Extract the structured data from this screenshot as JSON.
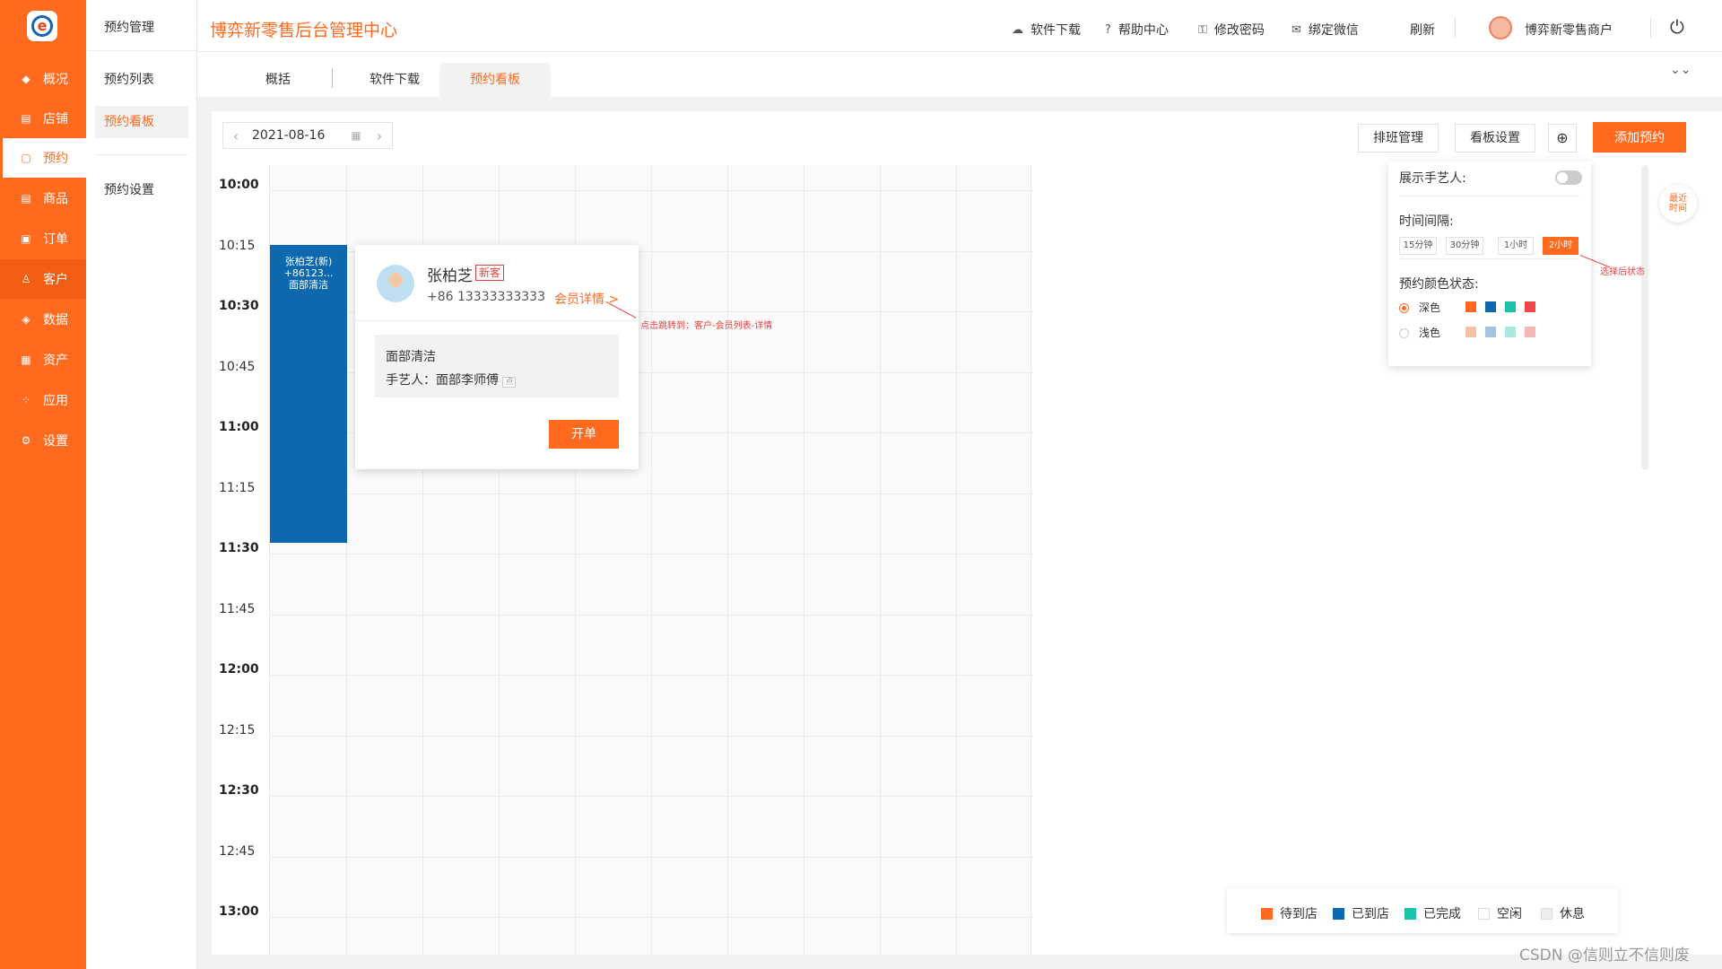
{
  "nav": {
    "items": [
      {
        "icon": "diamond-icon",
        "glyph": "◆",
        "label": "概况"
      },
      {
        "icon": "store-icon",
        "glyph": "▤",
        "label": "店铺"
      },
      {
        "icon": "calendar-icon",
        "glyph": "▢",
        "label": "预约"
      },
      {
        "icon": "goods-icon",
        "glyph": "▤",
        "label": "商品"
      },
      {
        "icon": "order-icon",
        "glyph": "▣",
        "label": "订单"
      },
      {
        "icon": "user-icon",
        "glyph": "♙",
        "label": "客户"
      },
      {
        "icon": "data-icon",
        "glyph": "◈",
        "label": "数据"
      },
      {
        "icon": "asset-icon",
        "glyph": "▦",
        "label": "资产"
      },
      {
        "icon": "apps-icon",
        "glyph": "⁘",
        "label": "应用"
      },
      {
        "icon": "settings-icon",
        "glyph": "⚙",
        "label": "设置"
      }
    ],
    "active_index": 2
  },
  "sub": {
    "title": "预约管理",
    "items": [
      "预约列表",
      "预约看板",
      "预约设置"
    ],
    "active_index": 1
  },
  "header": {
    "brand": "博弈新零售后台管理中心",
    "links": [
      {
        "icon": "cloud-download-icon",
        "glyph": "☁",
        "label": "软件下载"
      },
      {
        "icon": "help-icon",
        "glyph": "?",
        "label": "帮助中心"
      },
      {
        "icon": "lock-icon",
        "glyph": "⚿",
        "label": "修改密码"
      },
      {
        "icon": "wechat-icon",
        "glyph": "✉",
        "label": "绑定微信"
      }
    ],
    "refresh": "刷新",
    "merchant": "博弈新零售商户"
  },
  "tabs": {
    "items": [
      "概括",
      "软件下载",
      "预约看板"
    ],
    "active_index": 2
  },
  "toolbar": {
    "date": "2021-08-16",
    "schedule_btn": "排班管理",
    "board_settings_btn": "看板设置",
    "add_btn": "添加预约"
  },
  "times": [
    {
      "label": "10:00",
      "bold": true
    },
    {
      "label": "10:15",
      "bold": false
    },
    {
      "label": "10:30",
      "bold": true
    },
    {
      "label": "10:45",
      "bold": false
    },
    {
      "label": "11:00",
      "bold": true
    },
    {
      "label": "11:15",
      "bold": false
    },
    {
      "label": "11:30",
      "bold": true
    },
    {
      "label": "11:45",
      "bold": false
    },
    {
      "label": "12:00",
      "bold": true
    },
    {
      "label": "12:15",
      "bold": false
    },
    {
      "label": "12:30",
      "bold": true
    },
    {
      "label": "12:45",
      "bold": false
    },
    {
      "label": "13:00",
      "bold": true
    }
  ],
  "appointment": {
    "line1": "张柏芝(新)",
    "line2": "+86123...",
    "line3": "面部清洁",
    "color": "#0e68ad"
  },
  "popover": {
    "name": "张柏芝",
    "tag": "新客",
    "phone": "+86 13333333333",
    "detail_link": "会员详情 >",
    "service": "面部清洁",
    "artisan": "手艺人：面部李师傅",
    "artisan_badge": "点",
    "open_btn": "开单",
    "annotation": "点击跳转到：客户-会员列表-详情"
  },
  "settings": {
    "show_artisan_label": "展示手艺人:",
    "show_artisan_on": false,
    "interval_label": "时间间隔:",
    "intervals": [
      "15分钟",
      "30分钟",
      "1小时",
      "2小时"
    ],
    "interval_active": 3,
    "interval_annotation": "选择后状态",
    "color_label": "预约颜色状态:",
    "dark_label": "深色",
    "light_label": "浅色",
    "dark_colors": [
      "#ff6a1f",
      "#0e68ad",
      "#19c2a8",
      "#f04848"
    ],
    "light_colors": [
      "#f6c2a6",
      "#a3c3de",
      "#a9e8df",
      "#f5b8b8"
    ]
  },
  "recent": {
    "line1": "最近",
    "line2": "时间"
  },
  "legend": [
    {
      "label": "待到店",
      "color": "#ff6a1f",
      "kind": "fill"
    },
    {
      "label": "已到店",
      "color": "#0e68ad",
      "kind": "fill"
    },
    {
      "label": "已完成",
      "color": "#19c2a8",
      "kind": "fill"
    },
    {
      "label": "空闲",
      "color": "#ffffff",
      "kind": "empty"
    },
    {
      "label": "休息",
      "color": "#eeeeee",
      "kind": "rest"
    }
  ],
  "watermark": "CSDN @信则立不信则废",
  "accent": "#ff6a1f"
}
